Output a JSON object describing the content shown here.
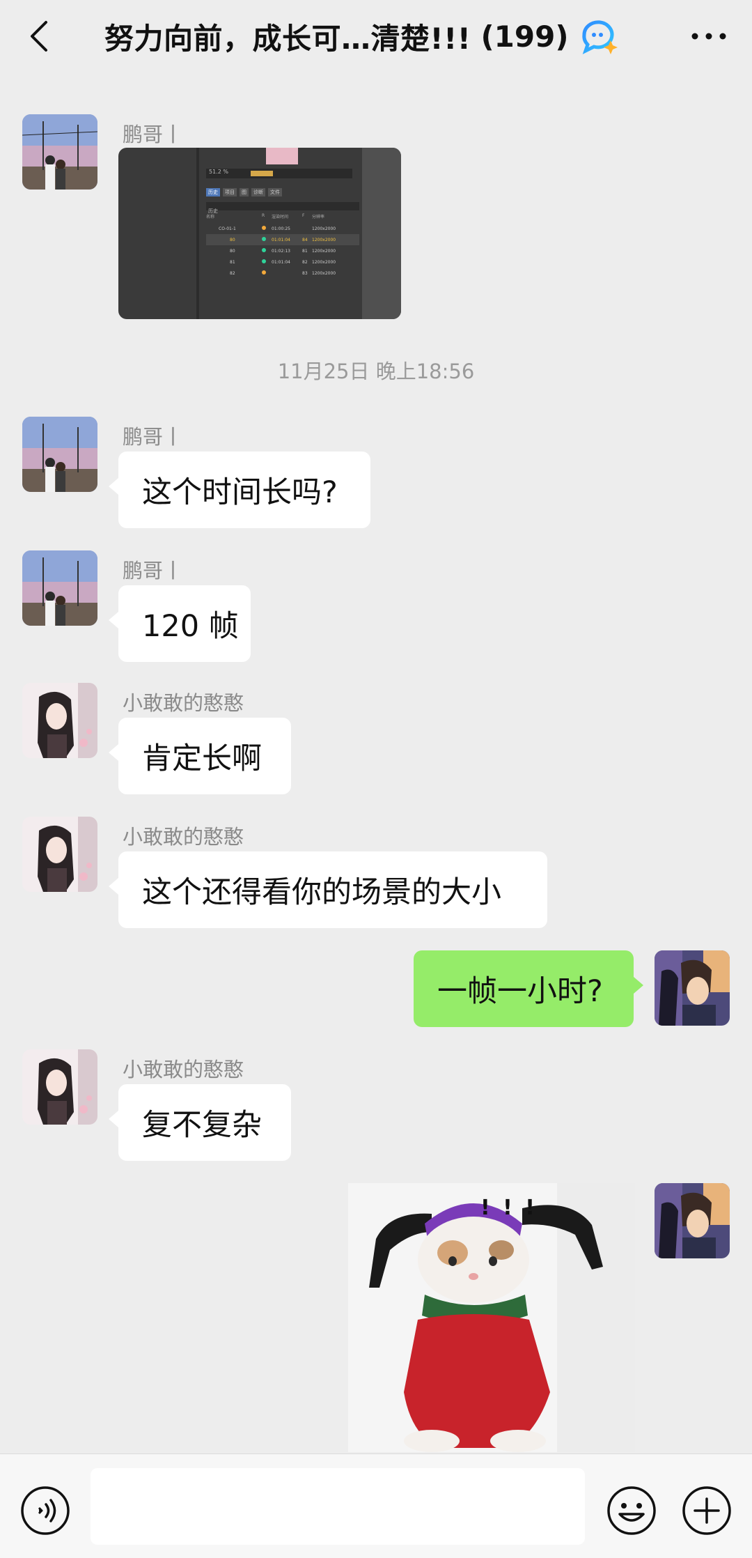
{
  "header": {
    "title": "努力向前，成长可…清楚!!!",
    "member_count": "(199)"
  },
  "messages": [
    {
      "sender": "鹏哥丨",
      "type": "image"
    },
    {
      "sender": "鹏哥丨",
      "text": "这个时间长吗?"
    },
    {
      "sender": "鹏哥丨",
      "text": "120 帧"
    },
    {
      "sender": "小敢敢的憨憨",
      "text": "肯定长啊"
    },
    {
      "sender": "小敢敢的憨憨",
      "text": "这个还得看你的场景的大小"
    },
    {
      "sender": "me",
      "text": "一帧一小时?"
    },
    {
      "sender": "小敢敢的憨憨",
      "text": "复不复杂"
    },
    {
      "sender": "me",
      "type": "sticker",
      "sticker_text": "! ! !"
    }
  ],
  "timestamp": "11月25日 晚上18:56",
  "screenshot": {
    "percent": "51.2 %",
    "tabs": [
      "历史",
      "项目",
      "图",
      "诊断",
      "文件"
    ],
    "section": "历史",
    "columns": [
      "名称",
      "R",
      "渲染时间",
      "F",
      "分辨率"
    ],
    "rows": [
      {
        "name": "CO-01-1",
        "time": "01:00:25",
        "f": "",
        "res": "1200x2000"
      },
      {
        "name": "80",
        "time": "01:01:04",
        "f": "84",
        "res": "1200x2000"
      },
      {
        "name": "80",
        "time": "01:02:13",
        "f": "81",
        "res": "1200x2000"
      },
      {
        "name": "81",
        "time": "01:01:04",
        "f": "82",
        "res": "1200x2000"
      },
      {
        "name": "82",
        "time": "",
        "f": "83",
        "res": "1200x2000"
      }
    ]
  },
  "colors": {
    "background": "#ededed",
    "bubble_in": "#ffffff",
    "bubble_out": "#95ec69",
    "sender_text": "#8a8a8a"
  },
  "input": {
    "placeholder": ""
  }
}
